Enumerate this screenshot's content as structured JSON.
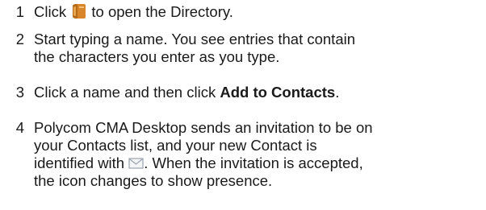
{
  "steps": [
    {
      "number": "1",
      "before": "Click",
      "icon": "directory-book-icon",
      "after": "to open the Directory."
    },
    {
      "number": "2",
      "line1": "Start typing a name. You see entries that contain",
      "line2": "the characters you enter as you type."
    },
    {
      "number": "3",
      "text": "Click a name and then click",
      "bold": "Add to Contacts",
      "end": "."
    },
    {
      "number": "4",
      "line1": "Polycom CMA Desktop sends an invitation to be on",
      "line2": "your Contacts list, and your new Contact is",
      "line3_before": "identified with",
      "icon": "envelope-icon",
      "line3_after": ". When the invitation is accepted,",
      "line4": "the icon changes to show presence."
    }
  ],
  "colors": {
    "text": "#1a1a1a",
    "directory_icon": "#d9862a",
    "envelope_icon": "#9aa3ad"
  }
}
